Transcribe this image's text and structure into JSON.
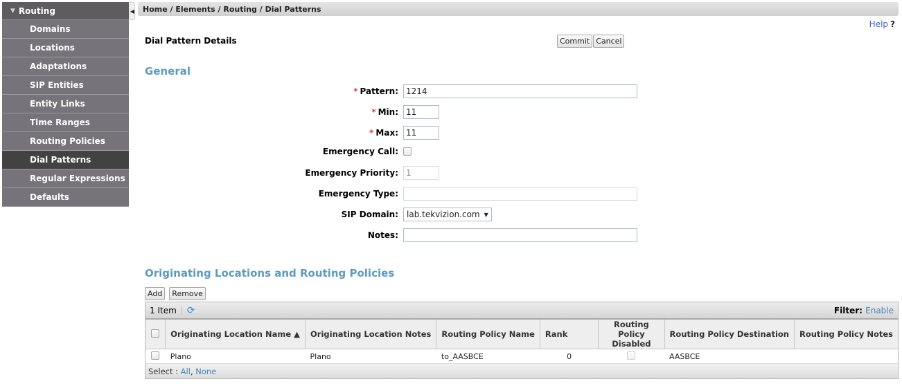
{
  "sidebar": {
    "header": "Routing",
    "items": [
      {
        "label": "Domains",
        "active": false
      },
      {
        "label": "Locations",
        "active": false
      },
      {
        "label": "Adaptations",
        "active": false
      },
      {
        "label": "SIP Entities",
        "active": false
      },
      {
        "label": "Entity Links",
        "active": false
      },
      {
        "label": "Time Ranges",
        "active": false
      },
      {
        "label": "Routing Policies",
        "active": false
      },
      {
        "label": "Dial Patterns",
        "active": true
      },
      {
        "label": "Regular Expressions",
        "active": false
      },
      {
        "label": "Defaults",
        "active": false
      }
    ]
  },
  "breadcrumb": "Home / Elements / Routing / Dial Patterns",
  "help": {
    "label": "Help",
    "icon": "?"
  },
  "page_title": "Dial Pattern Details",
  "buttons": {
    "commit": "Commit",
    "cancel": "Cancel"
  },
  "general": {
    "title": "General",
    "required_marker": "*",
    "fields": {
      "pattern": {
        "label": "Pattern:",
        "value": "1214"
      },
      "min": {
        "label": "Min:",
        "value": "11"
      },
      "max": {
        "label": "Max:",
        "value": "11"
      },
      "emergency_call": {
        "label": "Emergency Call:",
        "checked": false
      },
      "emergency_priority": {
        "label": "Emergency Priority:",
        "value": "1"
      },
      "emergency_type": {
        "label": "Emergency Type:",
        "value": ""
      },
      "sip_domain": {
        "label": "SIP Domain:",
        "value": "lab.tekvizion.com"
      },
      "notes": {
        "label": "Notes:",
        "value": ""
      }
    }
  },
  "routing": {
    "title": "Originating Locations and Routing Policies",
    "add_label": "Add",
    "remove_label": "Remove",
    "item_count": "1 Item",
    "filter_label": "Filter:",
    "filter_link": "Enable",
    "columns": [
      "Originating Location Name ▲",
      "Originating Location Notes",
      "Routing Policy Name",
      "Rank",
      "Routing Policy Disabled",
      "Routing Policy Destination",
      "Routing Policy Notes"
    ],
    "rows": [
      {
        "location_name": "Plano",
        "location_notes": "Plano",
        "policy_name": "to_AASBCE",
        "rank": "0",
        "disabled": false,
        "destination": "AASBCE",
        "policy_notes": ""
      }
    ],
    "footer": {
      "select_label": "Select :",
      "all": "All",
      "none": "None"
    }
  }
}
